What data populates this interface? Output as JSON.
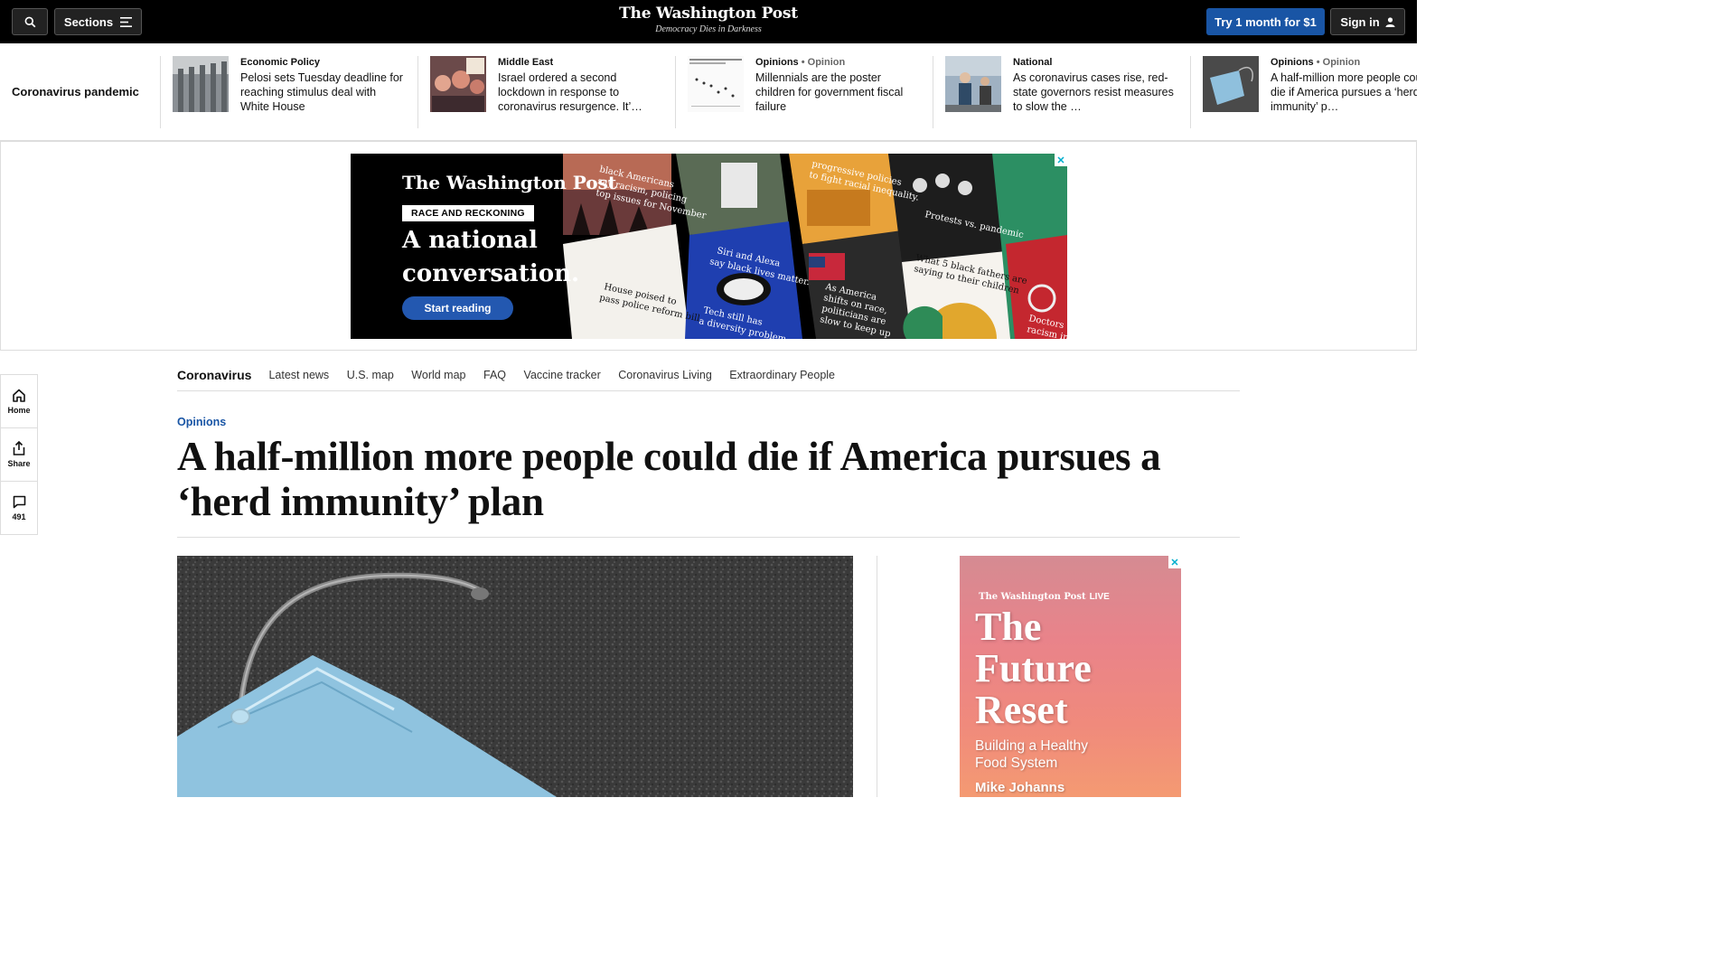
{
  "header": {
    "sections_label": "Sections",
    "logo_name": "The Washington Post",
    "logo_tagline": "Democracy Dies in Darkness",
    "subscribe_label": "Try 1 month for $1",
    "signin_label": "Sign in"
  },
  "strip": {
    "label": "Coronavirus pandemic",
    "cards": [
      {
        "kicker": "Economic Policy",
        "opinion": "",
        "headline": "Pelosi sets Tuesday deadline for reaching stimulus deal with White House"
      },
      {
        "kicker": "Middle East",
        "opinion": "",
        "headline": "Israel ordered a second lockdown in response to coronavirus resurgence. It’…"
      },
      {
        "kicker": "Opinions",
        "opinion": "• Opinion",
        "headline": "Millennials are the poster children for government fiscal failure"
      },
      {
        "kicker": "National",
        "opinion": "",
        "headline": "As coronavirus cases rise, red-state governors resist measures to slow the …"
      },
      {
        "kicker": "Opinions",
        "opinion": "• Opinion",
        "headline": "A half-million more people could die if America pursues a ‘herd immunity’ p…"
      }
    ]
  },
  "banner_ad": {
    "logo": "The Washington Post",
    "tag": "RACE AND RECKONING",
    "headline_line1": "A national",
    "headline_line2": "conversation.",
    "button": "Start reading",
    "close": "✕"
  },
  "subnav": {
    "lead": "Coronavirus",
    "items": [
      "Latest news",
      "U.S. map",
      "World map",
      "FAQ",
      "Vaccine tracker",
      "Coronavirus Living",
      "Extraordinary People"
    ]
  },
  "rail": {
    "home": "Home",
    "share": "Share",
    "comments": "491"
  },
  "article": {
    "kicker": "Opinions",
    "headline": "A half-million more people could die if America pursues a ‘herd immunity’ plan"
  },
  "side_ad": {
    "logo": "The Washington Post",
    "live": "LIVE",
    "title_line1": "The",
    "title_line2": "Future",
    "title_line3": "Reset",
    "subtitle_line1": "Building a Healthy",
    "subtitle_line2": "Food System",
    "speaker": "Mike Johanns",
    "close": "✕"
  },
  "colors": {
    "accent": "#1955a5",
    "topbar": "#000000"
  }
}
